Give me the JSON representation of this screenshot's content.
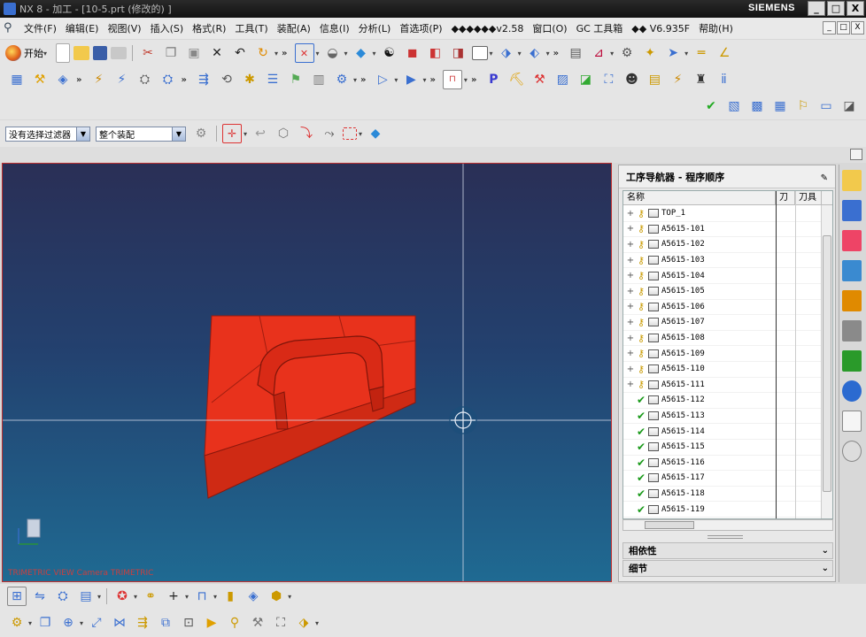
{
  "window": {
    "title": "NX 8 - 加工 - [10-5.prt  (修改的) ]",
    "brand": "SIEMENS",
    "controls": [
      "_",
      "□",
      "X"
    ]
  },
  "menubar": {
    "items": [
      "文件(F)",
      "编辑(E)",
      "视图(V)",
      "插入(S)",
      "格式(R)",
      "工具(T)",
      "装配(A)",
      "信息(I)",
      "分析(L)",
      "首选项(P)",
      "◆◆◆◆◆◆v2.58",
      "窗口(O)",
      "GC 工具箱",
      "◆◆ V6.935F",
      "帮助(H)"
    ],
    "mdi_controls": [
      "_",
      "□",
      "X"
    ]
  },
  "toolbar": {
    "start_label": "开始"
  },
  "filters": {
    "selection_filter": "没有选择过滤器",
    "scope": "整个装配"
  },
  "graphics": {
    "background_top": "#2a2f56",
    "background_bottom": "#1f6a92",
    "part_color": "#e8321c",
    "view_label": "TRIMETRIC VIEW Camera TRIMETRIC"
  },
  "navigator": {
    "title": "工序导航器 - 程序顺序",
    "columns": [
      "名称",
      "刀",
      "刀具"
    ],
    "rows": [
      {
        "name": "TOP_1",
        "status": "key",
        "expand": "+"
      },
      {
        "name": "A5615-101",
        "status": "key",
        "expand": "+"
      },
      {
        "name": "A5615-102",
        "status": "key",
        "expand": "+"
      },
      {
        "name": "A5615-103",
        "status": "key",
        "expand": "+"
      },
      {
        "name": "A5615-104",
        "status": "key",
        "expand": "+"
      },
      {
        "name": "A5615-105",
        "status": "key",
        "expand": "+"
      },
      {
        "name": "A5615-106",
        "status": "key",
        "expand": "+"
      },
      {
        "name": "A5615-107",
        "status": "key",
        "expand": "+"
      },
      {
        "name": "A5615-108",
        "status": "key",
        "expand": "+"
      },
      {
        "name": "A5615-109",
        "status": "key",
        "expand": "+"
      },
      {
        "name": "A5615-110",
        "status": "key",
        "expand": "+"
      },
      {
        "name": "A5615-111",
        "status": "key",
        "expand": "+"
      },
      {
        "name": "A5615-112",
        "status": "ok",
        "expand": ""
      },
      {
        "name": "A5615-113",
        "status": "ok",
        "expand": ""
      },
      {
        "name": "A5615-114",
        "status": "ok",
        "expand": ""
      },
      {
        "name": "A5615-115",
        "status": "ok",
        "expand": ""
      },
      {
        "name": "A5615-116",
        "status": "ok",
        "expand": ""
      },
      {
        "name": "A5615-117",
        "status": "ok",
        "expand": ""
      },
      {
        "name": "A5615-118",
        "status": "ok",
        "expand": ""
      },
      {
        "name": "A5615-119",
        "status": "ok",
        "expand": ""
      }
    ],
    "panels": [
      "相依性",
      "细节"
    ]
  }
}
